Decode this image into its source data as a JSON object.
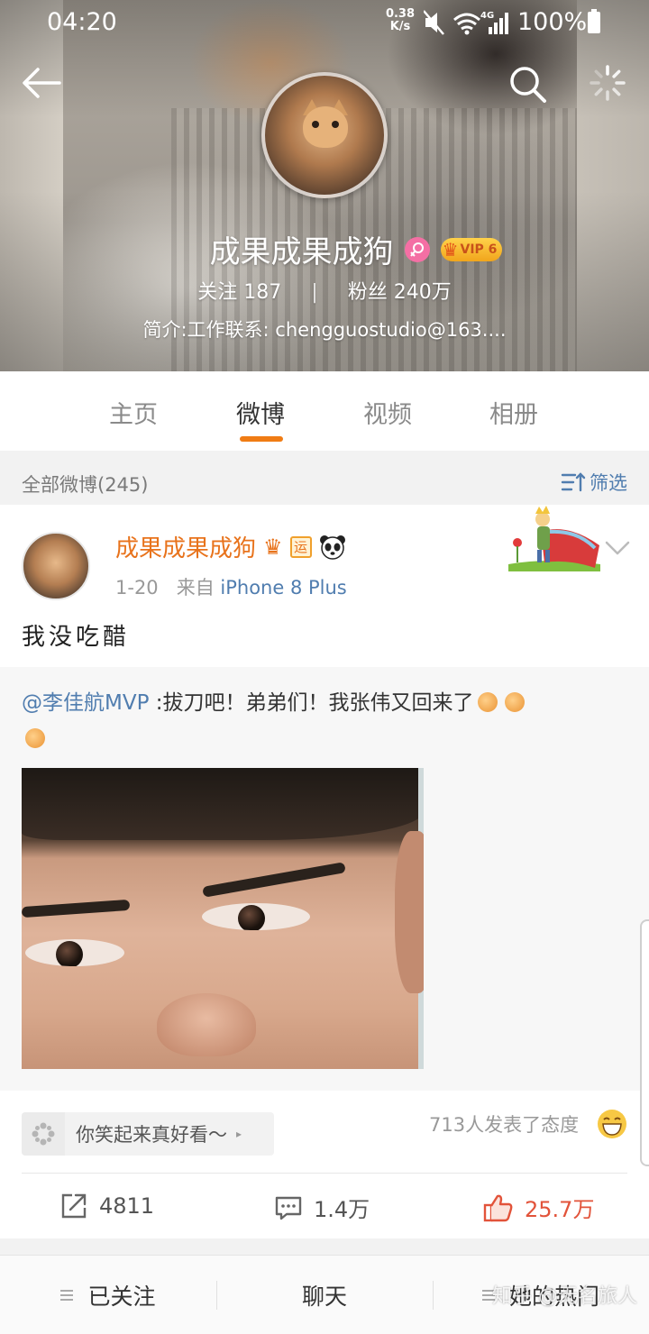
{
  "status_bar": {
    "time": "04:20",
    "net_speed_value": "0.38",
    "net_speed_unit": "K/s",
    "network": "4G",
    "battery": "100%"
  },
  "profile": {
    "name": "成果成果成狗",
    "vip_label": "VIP 6",
    "following_label": "关注",
    "following_count": "187",
    "separator": "|",
    "followers_label": "粉丝",
    "followers_count": "240万",
    "bio": "简介:工作联系: chengguostudio@163...."
  },
  "tabs": [
    {
      "label": "主页",
      "active": false
    },
    {
      "label": "微博",
      "active": true
    },
    {
      "label": "视频",
      "active": false
    },
    {
      "label": "相册",
      "active": false
    }
  ],
  "filter": {
    "count_label": "全部微博(245)",
    "filter_label": "筛选"
  },
  "post": {
    "author": "成果成果成狗",
    "badge_yun": "运",
    "date": "1-20",
    "source_prefix": "来自",
    "source": "iPhone 8 Plus",
    "text": "我没吃醋",
    "repost": {
      "mention": "@李佳航MVP",
      "text": " :拔刀吧！弟弟们！我张伟又回来了"
    },
    "mood_chip_label": "你笑起来真好看～",
    "attitude_text": "713人发表了态度",
    "actions": {
      "repost_count": "4811",
      "comment_count": "1.4万",
      "like_count": "25.7万"
    }
  },
  "bottom_bar": {
    "followed_label": "已关注",
    "chat_label": "聊天",
    "hot_label": "她的热门"
  },
  "watermark": "知乎 @无名旅人",
  "colors": {
    "accent_orange": "#f07c14",
    "link_blue": "#507daf",
    "like_red": "#e2533a",
    "username_orange": "#e8731c"
  }
}
